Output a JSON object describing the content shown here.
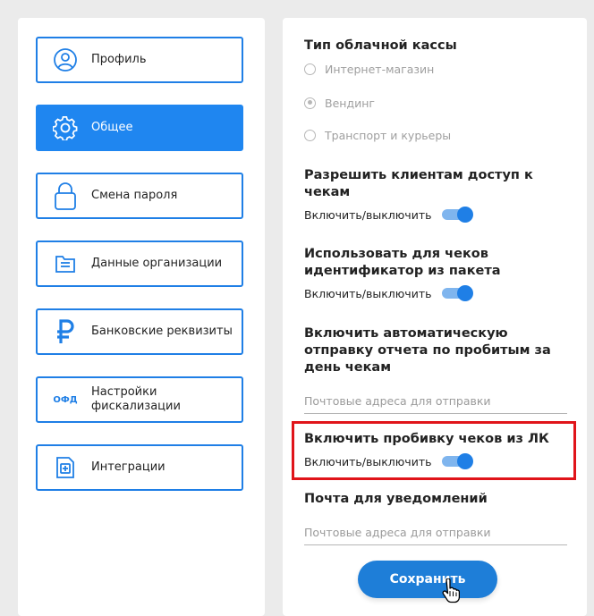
{
  "nav": {
    "items": [
      {
        "label": "Профиль",
        "icon": "user-icon",
        "active": false
      },
      {
        "label": "Общее",
        "icon": "gear-icon",
        "active": true
      },
      {
        "label": "Смена пароля",
        "icon": "lock-icon",
        "active": false
      },
      {
        "label": "Данные организации",
        "icon": "folder-icon",
        "active": false
      },
      {
        "label": "Банковские реквизиты",
        "icon": "ruble-icon",
        "active": false
      },
      {
        "label": "Настройки\nфискализации",
        "icon": "ofd-icon",
        "icon_text": "ОФД",
        "active": false
      },
      {
        "label": "Интеграции",
        "icon": "integration-icon",
        "active": false
      }
    ]
  },
  "settings": {
    "cashbox": {
      "title": "Тип облачной кассы",
      "options": [
        {
          "label": "Интернет-магазин",
          "checked": false
        },
        {
          "label": "Вендинг",
          "checked": true
        },
        {
          "label": "Транспорт и курьеры",
          "checked": false
        }
      ]
    },
    "client_access": {
      "title": "Разрешить клиентам доступ к чекам",
      "toggle_label": "Включить/выключить",
      "enabled": true
    },
    "package_id": {
      "title": "Использовать для чеков идентификатор из пакета",
      "toggle_label": "Включить/выключить",
      "enabled": true
    },
    "auto_report": {
      "title": "Включить автоматическую отправку отчета по пробитым за день чекам",
      "email_placeholder": "Почтовые адреса для отправки"
    },
    "lk_receipts": {
      "title": "Включить пробивку чеков из ЛК",
      "toggle_label": "Включить/выключить",
      "enabled": true
    },
    "notifications": {
      "title": "Почта для уведомлений",
      "email_placeholder": "Почтовые адреса для отправки"
    },
    "save_label": "Сохранить"
  },
  "colors": {
    "accent": "#1f86f0",
    "button": "#1e7ed8",
    "highlight": "#e0141a",
    "toggle_track": "#7fb5ee"
  }
}
